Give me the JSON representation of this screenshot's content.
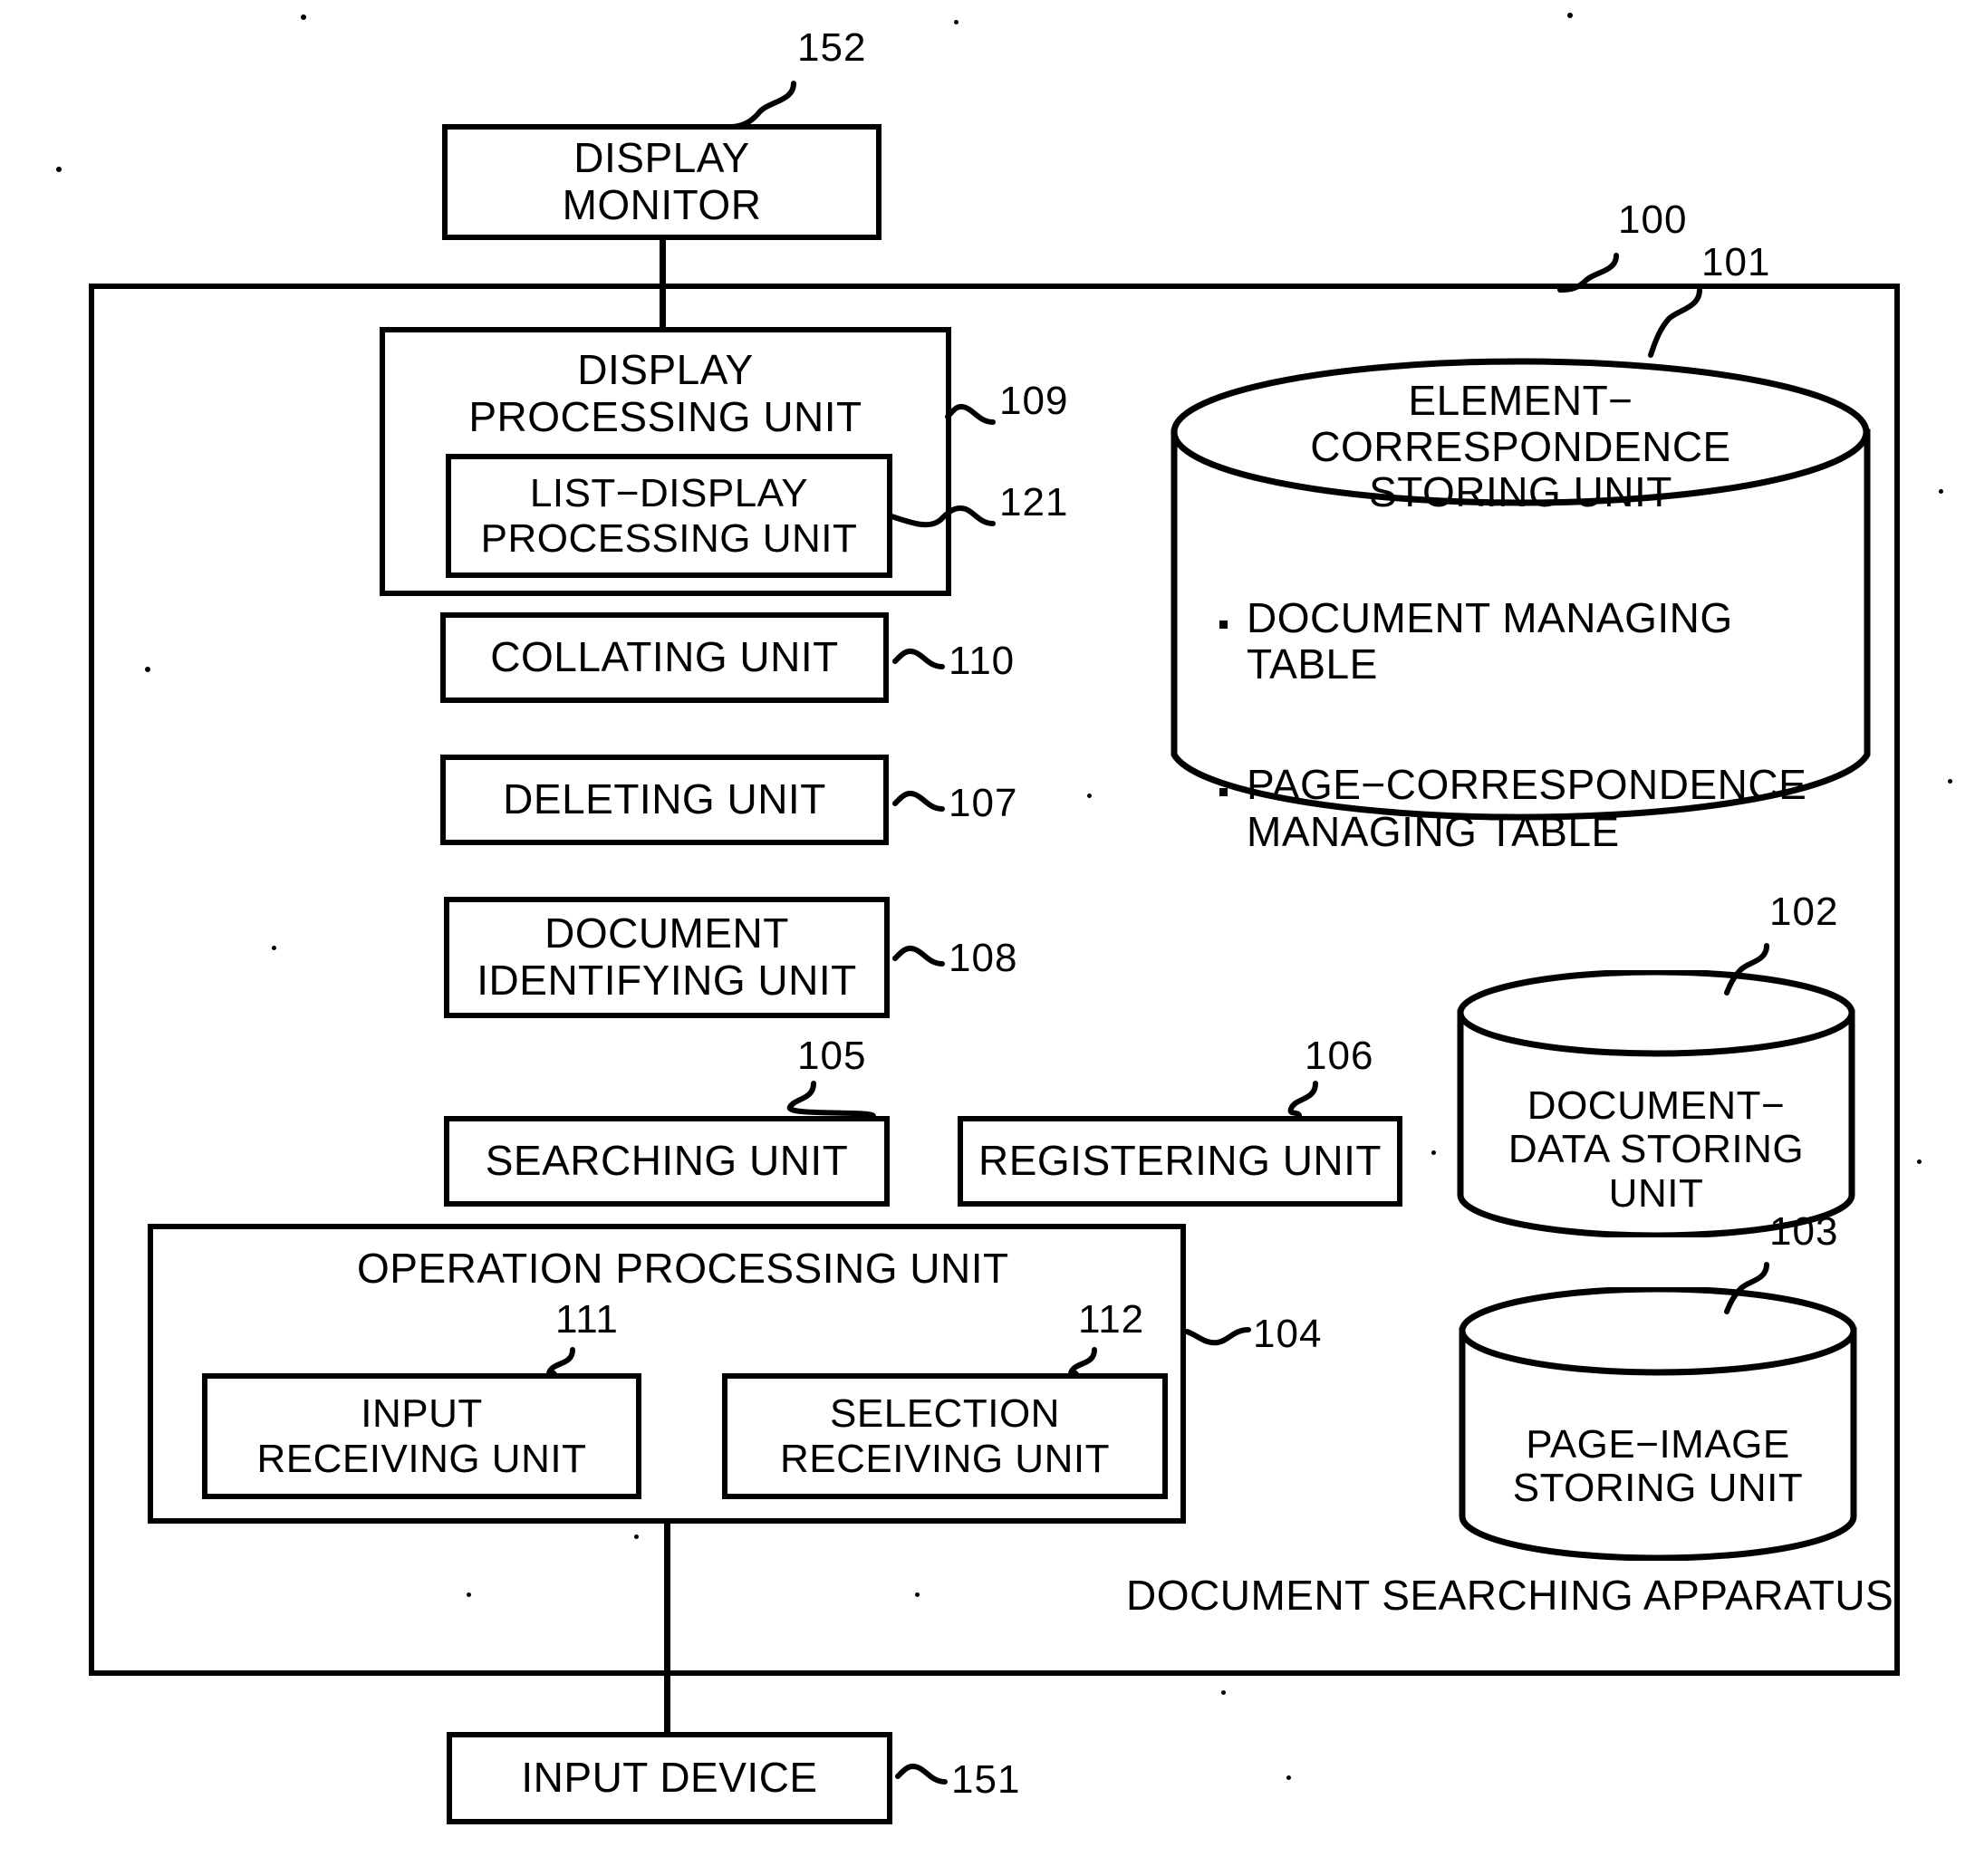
{
  "figure": {
    "type": "patent-block-diagram",
    "apparatus_label": "DOCUMENT SEARCHING APPARATUS",
    "apparatus_ref": "100"
  },
  "blocks": {
    "display_monitor": {
      "label": "DISPLAY\nMONITOR",
      "ref": "152"
    },
    "display_processing": {
      "label": "DISPLAY\nPROCESSING UNIT",
      "ref": "109"
    },
    "list_display": {
      "label": "LIST−DISPLAY\nPROCESSING UNIT",
      "ref": "121"
    },
    "collating": {
      "label": "COLLATING UNIT",
      "ref": "110"
    },
    "deleting": {
      "label": "DELETING UNIT",
      "ref": "107"
    },
    "document_identify": {
      "label": "DOCUMENT\nIDENTIFYING UNIT",
      "ref": "108"
    },
    "searching": {
      "label": "SEARCHING UNIT",
      "ref": "105"
    },
    "registering": {
      "label": "REGISTERING UNIT",
      "ref": "106"
    },
    "operation_processing": {
      "label": "OPERATION PROCESSING UNIT",
      "ref": "104"
    },
    "input_receiving": {
      "label": "INPUT\nRECEIVING UNIT",
      "ref": "111"
    },
    "selection_receiving": {
      "label": "SELECTION\nRECEIVING UNIT",
      "ref": "112"
    },
    "input_device": {
      "label": "INPUT DEVICE",
      "ref": "151"
    }
  },
  "stores": {
    "element_correspondence": {
      "label": "ELEMENT−\nCORRESPONDENCE\nSTORING UNIT",
      "ref": "101",
      "items": [
        "DOCUMENT MANAGING\nTABLE",
        "PAGE−CORRESPONDENCE\nMANAGING TABLE"
      ]
    },
    "document_data": {
      "label": "DOCUMENT−\nDATA STORING\nUNIT",
      "ref": "102"
    },
    "page_image": {
      "label": "PAGE−IMAGE\nSTORING UNIT",
      "ref": "103"
    }
  },
  "colors": {
    "ink": "#000000",
    "paper": "#ffffff"
  }
}
